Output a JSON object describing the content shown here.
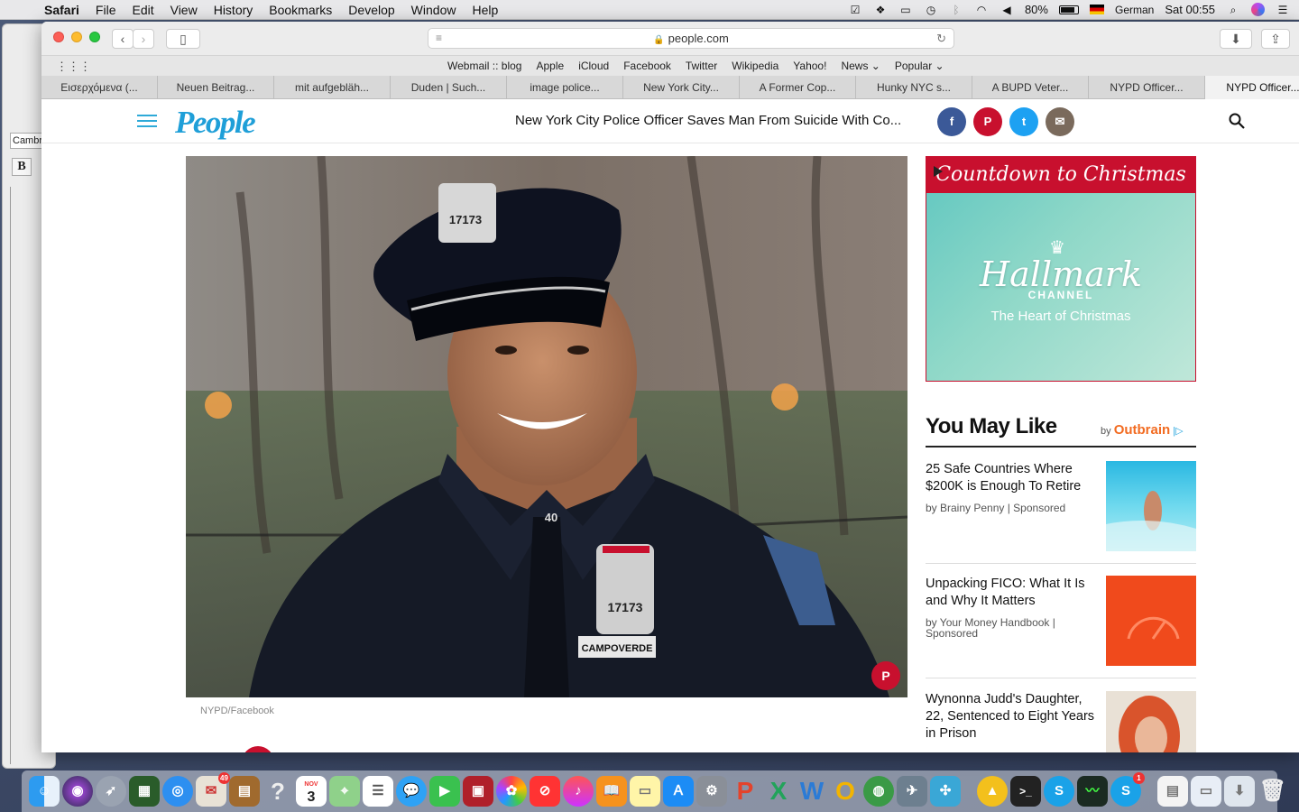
{
  "menubar": {
    "app": "Safari",
    "items": [
      "File",
      "Edit",
      "View",
      "History",
      "Bookmarks",
      "Develop",
      "Window",
      "Help"
    ],
    "battery": "80%",
    "language": "German",
    "clock": "Sat 00:55"
  },
  "word_window": {
    "font": "Cambr",
    "bold_label": "B"
  },
  "safari": {
    "url": "people.com",
    "favorites": [
      "Webmail :: blog",
      "Apple",
      "iCloud",
      "Facebook",
      "Twitter",
      "Wikipedia",
      "Yahoo!",
      "News ⌄",
      "Popular ⌄"
    ],
    "tabs": [
      "Εισερχόμενα (...",
      "Neuen Beitrag...",
      "mit aufgebläh...",
      "Duden | Such...",
      "image police...",
      "New York City...",
      "A Former Cop...",
      "Hunky NYC s...",
      "A BUPD Veter...",
      "NYPD Officer...",
      "NYPD Officer..."
    ]
  },
  "site": {
    "logo": "People",
    "headline": "New York City Police Officer Saves Man From Suicide With Co...",
    "share": [
      {
        "name": "facebook",
        "glyph": "f",
        "color": "#3b5998"
      },
      {
        "name": "pinterest",
        "glyph": "P",
        "color": "#c8102e"
      },
      {
        "name": "twitter",
        "glyph": "t",
        "color": "#1da1f2"
      },
      {
        "name": "email",
        "glyph": "✉",
        "color": "#7a6a5c"
      }
    ],
    "photo_credit": "NYPD/Facebook",
    "badge_number": "17173",
    "nameplate": "CAMPOVERDE",
    "collar_number": "40",
    "pin_glyph": "P"
  },
  "ad": {
    "banner": "Countdown to Christmas",
    "brand": "Hallmark",
    "channel": "CHANNEL",
    "tagline": "The Heart of Christmas"
  },
  "you_may_like": {
    "title": "You May Like",
    "by": "by",
    "provider": "Outbrain",
    "items": [
      {
        "title": "25 Safe Countries Where $200K is Enough To Retire",
        "source": "by Brainy Penny | Sponsored"
      },
      {
        "title": "Unpacking FICO: What It Is and Why It Matters",
        "source": "by Your Money Handbook | Sponsored"
      },
      {
        "title": "Wynonna Judd's Daughter, 22, Sentenced to Eight Years in Prison",
        "source": ""
      }
    ]
  },
  "dock": {
    "calendar_month": "NOV",
    "calendar_day": "3",
    "mail_badge": "49",
    "skype_badge": "1"
  }
}
